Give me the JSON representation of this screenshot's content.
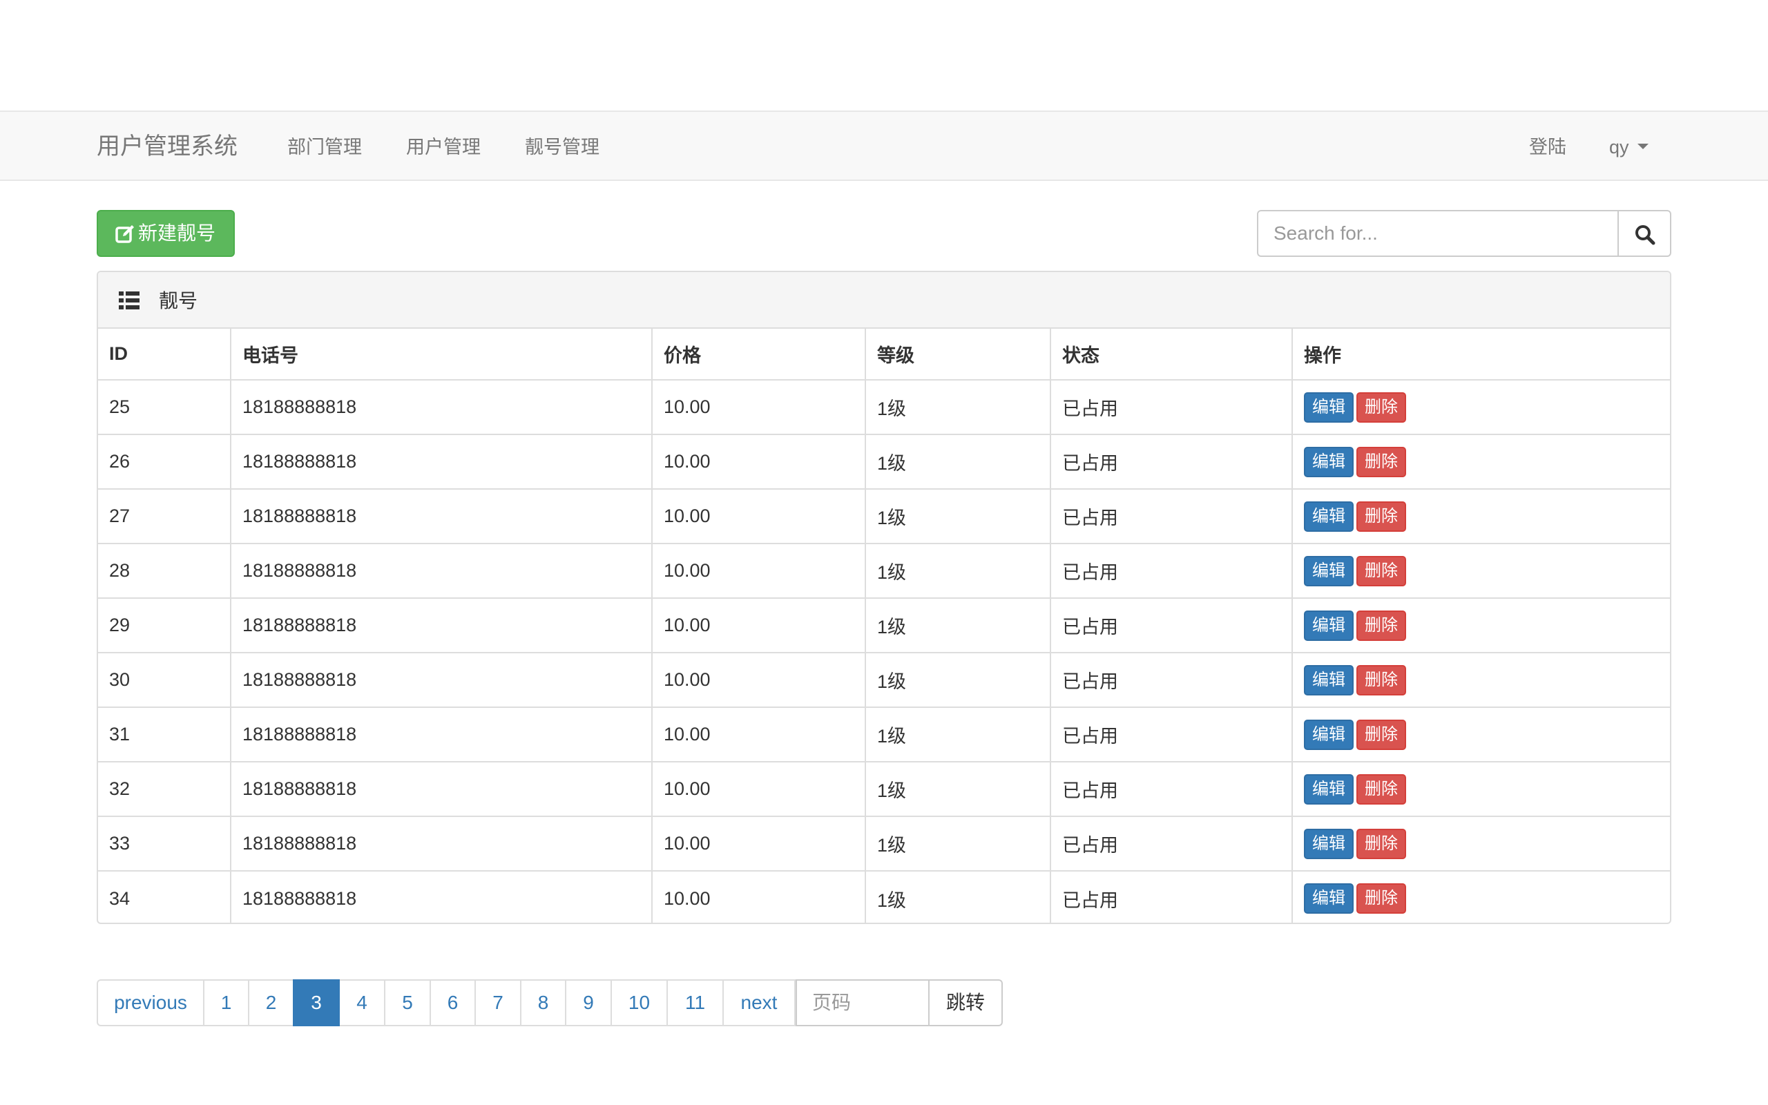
{
  "navbar": {
    "brand": "用户管理系统",
    "links": [
      "部门管理",
      "用户管理",
      "靓号管理"
    ],
    "login": "登陆",
    "user": "qy"
  },
  "toolbar": {
    "new_button": "新建靓号",
    "search_placeholder": "Search for..."
  },
  "panel": {
    "title": "靓号",
    "columns": [
      "ID",
      "电话号",
      "价格",
      "等级",
      "状态",
      "操作"
    ],
    "edit_label": "编辑",
    "delete_label": "删除",
    "rows": [
      {
        "id": "25",
        "mobile": "18188888818",
        "price": "10.00",
        "level": "1级",
        "status": "已占用"
      },
      {
        "id": "26",
        "mobile": "18188888818",
        "price": "10.00",
        "level": "1级",
        "status": "已占用"
      },
      {
        "id": "27",
        "mobile": "18188888818",
        "price": "10.00",
        "level": "1级",
        "status": "已占用"
      },
      {
        "id": "28",
        "mobile": "18188888818",
        "price": "10.00",
        "level": "1级",
        "status": "已占用"
      },
      {
        "id": "29",
        "mobile": "18188888818",
        "price": "10.00",
        "level": "1级",
        "status": "已占用"
      },
      {
        "id": "30",
        "mobile": "18188888818",
        "price": "10.00",
        "level": "1级",
        "status": "已占用"
      },
      {
        "id": "31",
        "mobile": "18188888818",
        "price": "10.00",
        "level": "1级",
        "status": "已占用"
      },
      {
        "id": "32",
        "mobile": "18188888818",
        "price": "10.00",
        "level": "1级",
        "status": "已占用"
      },
      {
        "id": "33",
        "mobile": "18188888818",
        "price": "10.00",
        "level": "1级",
        "status": "已占用"
      },
      {
        "id": "34",
        "mobile": "18188888818",
        "price": "10.00",
        "level": "1级",
        "status": "已占用"
      }
    ]
  },
  "pagination": {
    "previous": "previous",
    "pages": [
      "1",
      "2",
      "3",
      "4",
      "5",
      "6",
      "7",
      "8",
      "9",
      "10",
      "11"
    ],
    "active": "3",
    "next": "next",
    "jump_placeholder": "页码",
    "jump_button": "跳转"
  },
  "colors": {
    "primary": "#337ab7",
    "success": "#5cb85c",
    "danger": "#d9534f"
  },
  "icons": {
    "new_button_icon": "edit-icon",
    "search_icon": "search-icon",
    "panel_icon": "list-icon",
    "user_menu_icon": "caret-down-icon"
  }
}
